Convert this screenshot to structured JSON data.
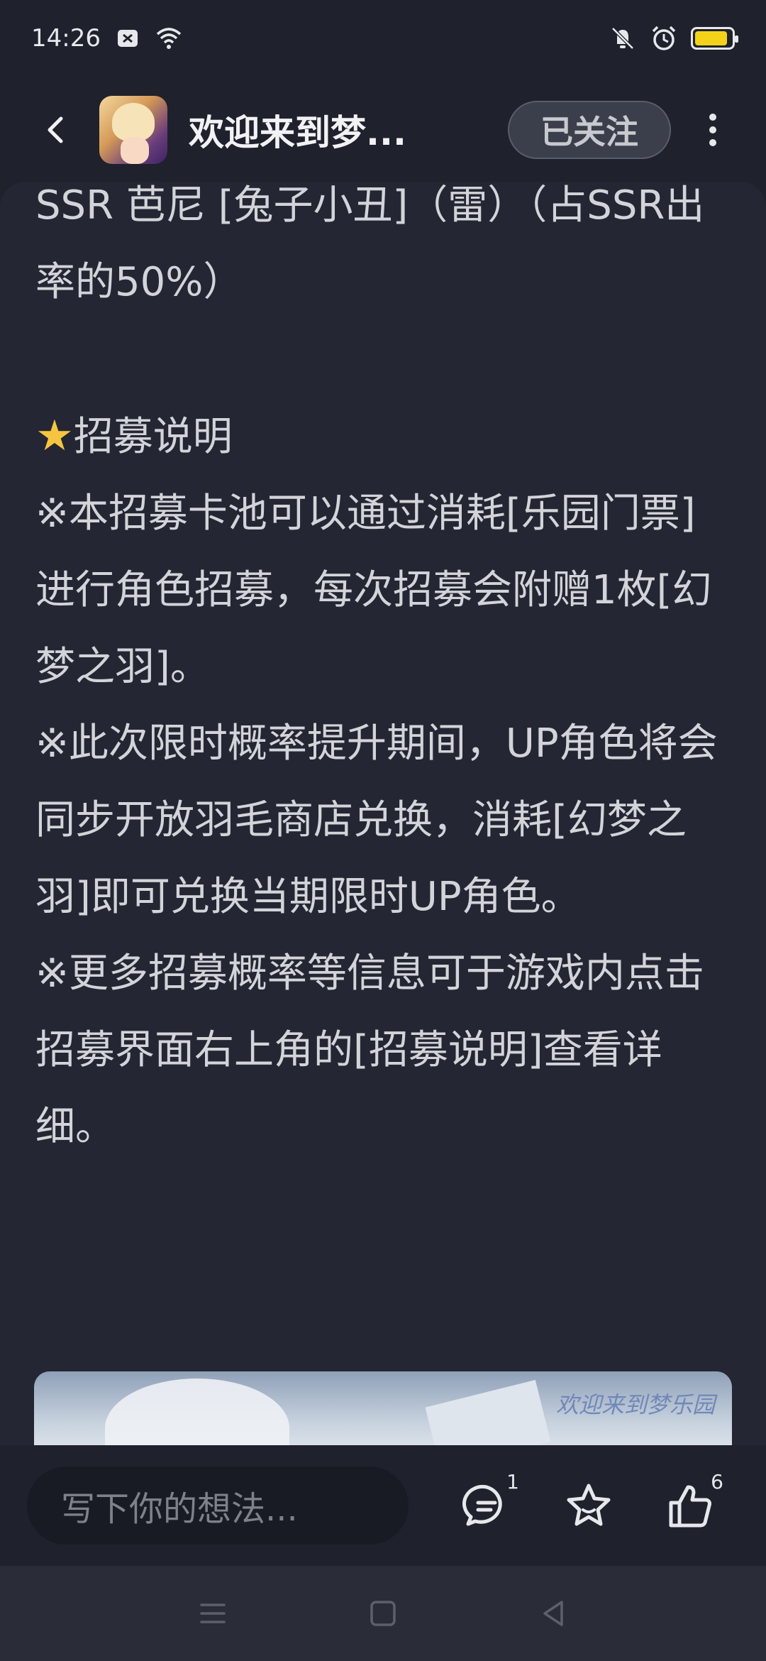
{
  "status_bar": {
    "time": "14:26",
    "battery_level": 0.9,
    "colors": {
      "battery": "#f4d21a"
    }
  },
  "header": {
    "title": "欢迎来到梦...",
    "follow_label": "已关注"
  },
  "article": {
    "paragraphs": [
      "SSR 芭尼 [兔子小丑]（雷）（占SSR出率的50%）",
      "",
      "招募说明",
      "※本招募卡池可以通过消耗[乐园门票]进行角色招募，每次招募会附赠1枚[幻梦之羽]。",
      "※此次限时概率提升期间，UP角色将会同步开放羽毛商店兑换，消耗[幻梦之羽]即可兑换当期限时UP角色。",
      "※更多招募概率等信息可于游戏内点击招募界面右上角的[招募说明]查看详细。"
    ],
    "section_icon": "star-icon",
    "image_watermark": "欢迎来到梦乐园"
  },
  "bottom_bar": {
    "comment_placeholder": "写下你的想法...",
    "comment_count": "1",
    "like_count": "6"
  },
  "colors": {
    "background": "#1f212c",
    "content_bg": "#242633",
    "text": "#d3d4d9",
    "star": "#f5c542"
  }
}
